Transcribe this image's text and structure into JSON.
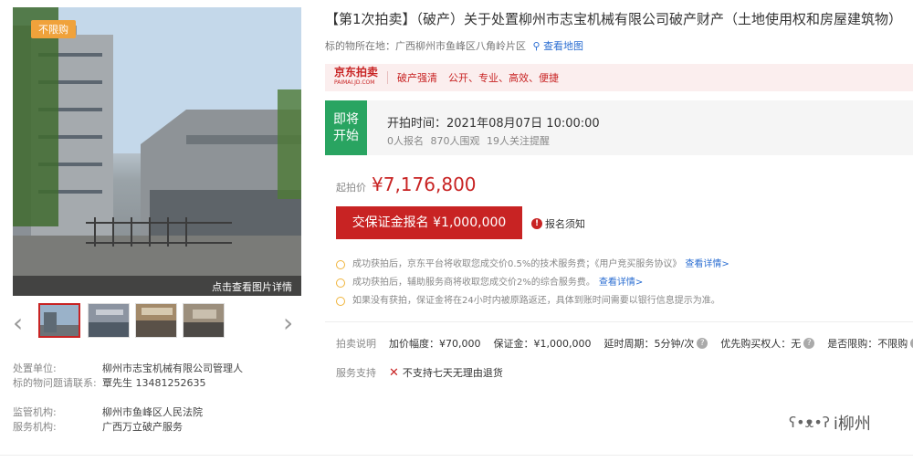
{
  "photo": {
    "badge": "不限购",
    "caption": "点击查看图片详情"
  },
  "thumbnails": {
    "prev_arrow": "‹",
    "next_arrow": "›",
    "count": 4
  },
  "info": [
    {
      "label": "处置单位:",
      "value": "柳州市志宝机械有限公司管理人"
    },
    {
      "label": "标的物问题请联系:",
      "value": "覃先生 13481252635"
    },
    {
      "label": "监管机构:",
      "value": "柳州市鱼峰区人民法院"
    },
    {
      "label": "服务机构:",
      "value": "广西万立破产服务"
    }
  ],
  "title": "【第1次拍卖】（破产）关于处置柳州市志宝机械有限公司破产财产（土地使用权和房屋建筑物）",
  "location": {
    "label": "标的物所在地：广西柳州市鱼峰区八角岭片区",
    "map_link": "查看地图"
  },
  "slogan": {
    "logo_text": "京东拍卖",
    "logo_sub": "PAIMAI.JD.COM",
    "tag": "破产强清",
    "text": "公开、专业、高效、便捷"
  },
  "auction": {
    "status": "即将开始",
    "start_time": "开拍时间：2021年08月07日 10:00:00",
    "stats": "0人报名  870人围观  19人关注提醒"
  },
  "price": {
    "label": "起拍价",
    "value": "¥7,176,800"
  },
  "deposit_button": "交保证金报名 ¥1,000,000",
  "notice_link": "报名须知",
  "tips": [
    {
      "text": "成功获拍后，京东平台将收取您成交价0.5%的技术服务费；《用户竞买服务协议》",
      "link": "查看详情>"
    },
    {
      "text": "成功获拍后，辅助服务商将收取您成交价2%的综合服务费。",
      "link": "查看详情>"
    },
    {
      "text": "如果没有获拍，保证金将在24小时内被原路返还，具体到账时间需要以银行信息提示为准。",
      "link": ""
    }
  ],
  "params": {
    "label": "拍卖说明",
    "increment": "加价幅度：¥70,000",
    "deposit": "保证金：¥1,000,000",
    "delay": "延时周期：5分钟/次",
    "priority": "优先购买权人：无",
    "limit": "是否限购：不限购"
  },
  "service": {
    "label": "服务支持",
    "text": "不支持七天无理由退货"
  },
  "watermark": "i柳州",
  "colors": {
    "accent": "#c82323",
    "status_green": "#29a461",
    "link": "#2b6ed2"
  }
}
